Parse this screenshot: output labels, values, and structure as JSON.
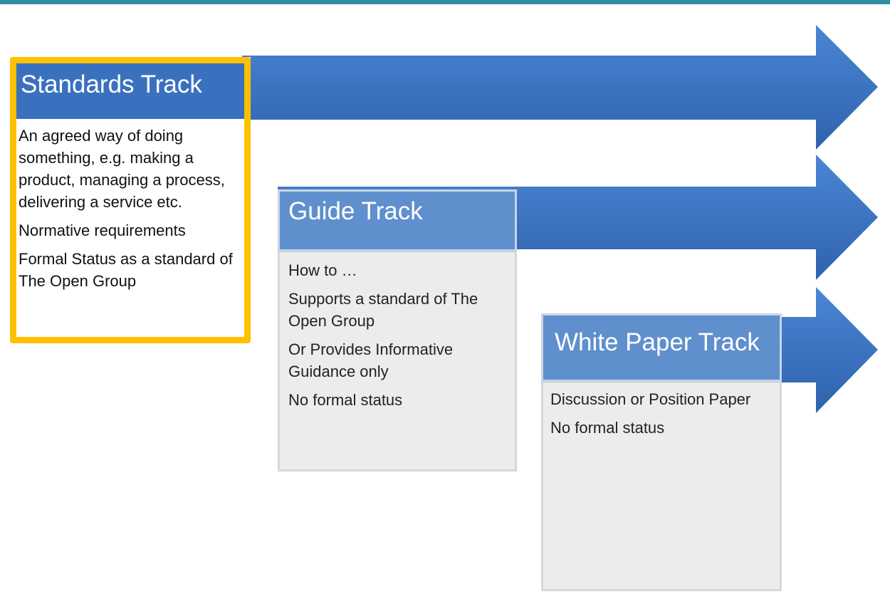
{
  "colors": {
    "accent_bar": "#2f8ea3",
    "arrow_blue": "#3a71bf",
    "highlight_frame": "#ffc000",
    "header_blue_translucent": "#5f8fcd",
    "card_grey": "#ececec"
  },
  "tracks": [
    {
      "title": "Standards Track",
      "highlighted": true,
      "lines": [
        "An agreed way of doing something, e.g. making a product, managing a process, delivering a service etc.",
        "Normative requirements",
        "Formal Status as a standard of The Open Group"
      ]
    },
    {
      "title": "Guide Track",
      "highlighted": false,
      "lines": [
        "How to …",
        "Supports a standard of The Open Group",
        "Or Provides Informative Guidance only",
        "No formal status"
      ]
    },
    {
      "title": "White Paper Track",
      "highlighted": false,
      "lines": [
        "Discussion or Position Paper",
        "No formal status"
      ]
    }
  ]
}
